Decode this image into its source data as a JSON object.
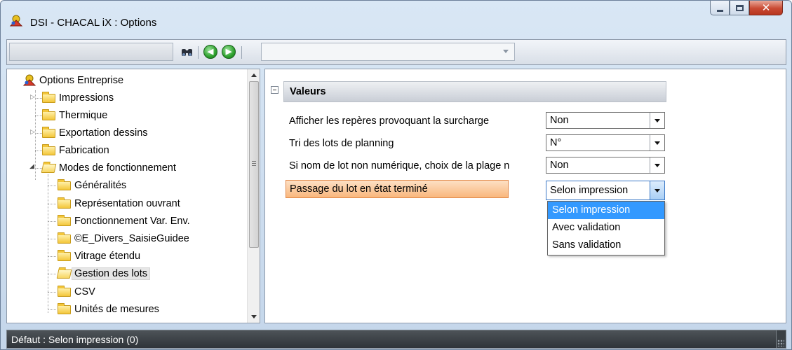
{
  "window": {
    "title": "DSI - CHACAL iX : Options",
    "controls": [
      "minimize-icon",
      "maximize-icon",
      "close-icon"
    ]
  },
  "toolbar": {
    "search_value": "",
    "icons": [
      "binoculars-icon",
      "back-arrow-icon",
      "forward-arrow-icon"
    ],
    "combo_value": ""
  },
  "tree": {
    "root": "Options Entreprise",
    "items": [
      {
        "label": "Impressions",
        "level": 1,
        "expandable": true
      },
      {
        "label": "Thermique",
        "level": 1,
        "expandable": false
      },
      {
        "label": "Exportation dessins",
        "level": 1,
        "expandable": true
      },
      {
        "label": "Fabrication",
        "level": 1,
        "expandable": false
      },
      {
        "label": "Modes de fonctionnement",
        "level": 1,
        "expanded": true
      },
      {
        "label": "Généralités",
        "level": 2
      },
      {
        "label": "Représentation ouvrant",
        "level": 2
      },
      {
        "label": "Fonctionnement Var. Env.",
        "level": 2
      },
      {
        "label": "©E_Divers_SaisieGuidee",
        "level": 2
      },
      {
        "label": "Vitrage étendu",
        "level": 2
      },
      {
        "label": "Gestion des lots",
        "level": 2,
        "selected": true
      },
      {
        "label": "CSV",
        "level": 2
      },
      {
        "label": "Unités de mesures",
        "level": 2
      }
    ]
  },
  "properties": {
    "section_title": "Valeurs",
    "rows": [
      {
        "label": "Afficher les repères provoquant la surcharge",
        "value": "Non"
      },
      {
        "label": "Tri des lots de planning",
        "value": "N°"
      },
      {
        "label": "Si nom de lot non numérique, choix de la plage n",
        "value": "Non"
      },
      {
        "label": "Passage du lot en état terminé",
        "value": "Selon impression",
        "highlighted": true
      }
    ],
    "dropdown_options": [
      "Selon impression",
      "Avec validation",
      "Sans validation"
    ],
    "dropdown_selected": "Selon impression"
  },
  "statusbar": {
    "text": "Défaut : Selon impression (0)"
  },
  "colors": {
    "selection_blue": "#3399ff",
    "highlight_orange": "#f9b77c",
    "status_bg": "#33383d"
  }
}
